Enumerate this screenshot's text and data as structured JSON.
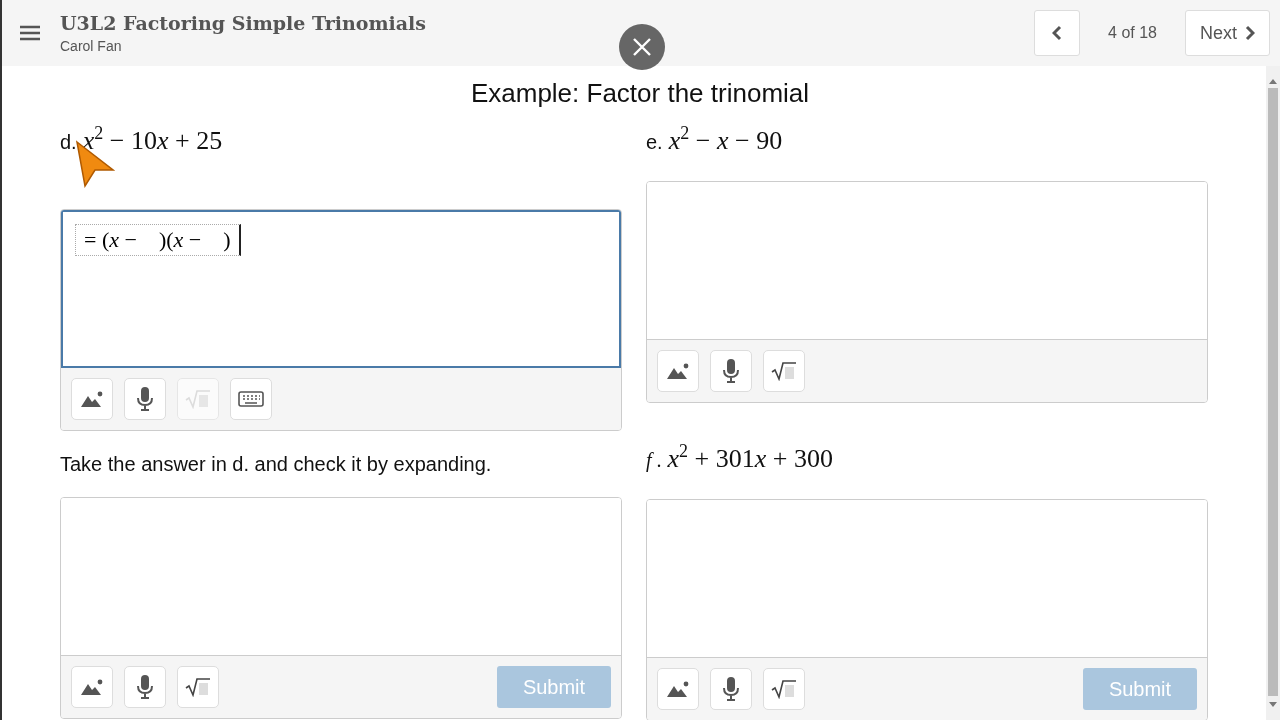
{
  "header": {
    "title": "U3L2 Factoring Simple Trinomials",
    "author": "Carol Fan",
    "counter": "4 of 18",
    "next": "Next"
  },
  "heading": "Example: Factor the trinomial",
  "columns": [
    {
      "items": [
        {
          "kind": "problem",
          "label": "d.",
          "expr": [
            {
              "kind": "var",
              "text": "x"
            },
            {
              "kind": "sup",
              "text": "2"
            },
            {
              "kind": "op",
              "text": " − "
            },
            {
              "kind": "num",
              "text": "10"
            },
            {
              "kind": "var",
              "text": "x"
            },
            {
              "kind": "op",
              "text": " + "
            },
            {
              "kind": "num",
              "text": "25"
            }
          ]
        },
        {
          "kind": "answer",
          "focused": true,
          "value": [
            {
              "kind": "op",
              "text": "= ("
            },
            {
              "kind": "var",
              "text": "x"
            },
            {
              "kind": "op",
              "text": " −    )("
            },
            {
              "kind": "var",
              "text": "x"
            },
            {
              "kind": "op",
              "text": " −    )"
            }
          ],
          "tools": [
            {
              "kind": "image",
              "disabled": false
            },
            {
              "kind": "mic",
              "disabled": false
            },
            {
              "kind": "math",
              "disabled": true
            },
            {
              "kind": "keyboard",
              "disabled": false
            }
          ]
        },
        {
          "kind": "prompt",
          "text": "Take the answer in d. and check it by expanding."
        },
        {
          "kind": "answer",
          "focused": false,
          "tools": [
            {
              "kind": "image",
              "disabled": false
            },
            {
              "kind": "mic",
              "disabled": false
            },
            {
              "kind": "math",
              "disabled": false
            }
          ],
          "submit": {
            "label": "Submit",
            "disabled": true
          }
        }
      ]
    },
    {
      "items": [
        {
          "kind": "problem",
          "label": "e.",
          "expr": [
            {
              "kind": "var",
              "text": "x"
            },
            {
              "kind": "sup",
              "text": "2"
            },
            {
              "kind": "op",
              "text": " − "
            },
            {
              "kind": "var",
              "text": "x"
            },
            {
              "kind": "op",
              "text": " − "
            },
            {
              "kind": "num",
              "text": "90"
            }
          ]
        },
        {
          "kind": "answer",
          "focused": false,
          "tools": [
            {
              "kind": "image",
              "disabled": false
            },
            {
              "kind": "mic",
              "disabled": false
            },
            {
              "kind": "math",
              "disabled": false
            }
          ]
        },
        {
          "kind": "problem",
          "label": "*f* .",
          "expr": [
            {
              "kind": "var",
              "text": "x"
            },
            {
              "kind": "sup",
              "text": "2"
            },
            {
              "kind": "op",
              "text": " + "
            },
            {
              "kind": "num",
              "text": "301"
            },
            {
              "kind": "var",
              "text": "x"
            },
            {
              "kind": "op",
              "text": " + "
            },
            {
              "kind": "num",
              "text": "300"
            }
          ]
        },
        {
          "kind": "answer",
          "focused": false,
          "tools": [
            {
              "kind": "image",
              "disabled": false
            },
            {
              "kind": "mic",
              "disabled": false
            },
            {
              "kind": "math",
              "disabled": false
            }
          ],
          "submit": {
            "label": "Submit",
            "disabled": true
          }
        }
      ]
    }
  ]
}
